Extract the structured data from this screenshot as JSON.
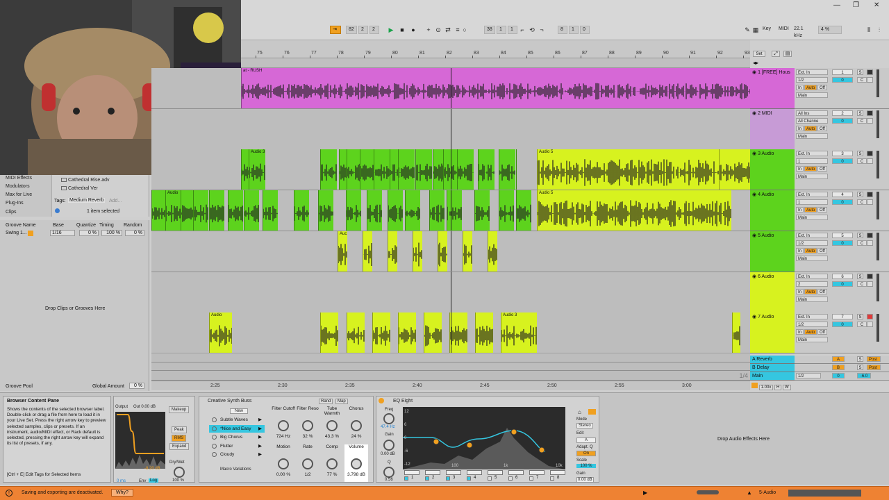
{
  "window": {
    "minimize": "—",
    "restore": "❐",
    "close": "✕"
  },
  "transport": {
    "tempo_controls": [
      "82",
      "2",
      "2"
    ],
    "position": [
      "38",
      "1",
      "1"
    ],
    "loop_length": [
      "8",
      "1",
      "0"
    ],
    "key_label": "Key",
    "midi_label": "MIDI",
    "sample_rate": "22.1 kHz",
    "cpu": "4 %"
  },
  "ruler": {
    "bars": [
      "75",
      "76",
      "77",
      "78",
      "79",
      "80",
      "81",
      "82",
      "83",
      "84",
      "85",
      "86",
      "87",
      "88",
      "89",
      "90",
      "91",
      "92",
      "93"
    ],
    "set_label": "Set",
    "times": [
      "2:25",
      "2:30",
      "2:35",
      "2:40",
      "2:45",
      "2:50",
      "2:55",
      "3:00"
    ]
  },
  "browser": {
    "categories": [
      "MIDI Effects",
      "Modulators",
      "Max for Live",
      "Plug-Ins",
      "Clips"
    ],
    "files": [
      "Cathedral Rise.adv",
      "Cathedral Ver"
    ],
    "tags_label": "Tags:",
    "tag_value": "Medium Reverb",
    "tag_add": "Add...",
    "selection": "1 item selected"
  },
  "groove": {
    "headers": [
      "Groove Name",
      "Base",
      "Quantize",
      "Timing",
      "Random"
    ],
    "row": {
      "name": "Swing 1...",
      "base": "1/16",
      "quantize": "0 %",
      "timing": "100 %",
      "random": "0 %"
    },
    "drop_hint": "Drop Clips or Grooves Here",
    "pool_label": "Groove Pool",
    "global_label": "Global Amount",
    "global_value": "0 %"
  },
  "tracks": [
    {
      "name": "1 [FREE] Hous",
      "color": "#d668d6",
      "input": "Ext. In",
      "channel": "1/2",
      "number": "1",
      "volume": "0",
      "pan": "C",
      "output": "Main",
      "clip_label": "at - RUSH"
    },
    {
      "name": "2 MIDI",
      "color": "#c79bd6",
      "input": "All Ins",
      "channel": "All Channe",
      "number": "2",
      "volume": "0",
      "pan": "C",
      "output": "Main"
    },
    {
      "name": "3 Audio",
      "color": "#5dd31d",
      "input": "Ext. In",
      "channel": "1",
      "number": "3",
      "volume": "0",
      "pan": "C",
      "output": "Main",
      "clip_label": "Audio 3",
      "clip_label_b": "Audio 5"
    },
    {
      "name": "4 Audio",
      "color": "#5dd31d",
      "input": "Ext. In",
      "channel": "1",
      "number": "4",
      "volume": "0",
      "pan": "C",
      "output": "Main",
      "clip_label": "Audio",
      "clip_label_b": "Audio 5"
    },
    {
      "name": "5 Audio",
      "color": "#5dd31d",
      "input": "Ext. In",
      "channel": "1/2",
      "number": "5",
      "volume": "0",
      "pan": "C",
      "output": "Main",
      "clip_label": "Auc"
    },
    {
      "name": "6 Audio",
      "color": "#d7f21f",
      "input": "Ext. In",
      "channel": "2",
      "number": "6",
      "volume": "0",
      "pan": "C",
      "output": "Main"
    },
    {
      "name": "7 Audio",
      "color": "#d7f21f",
      "input": "Ext. In",
      "channel": "1/2",
      "number": "7",
      "volume": "0",
      "pan": "C",
      "output": "Main",
      "clip_label": "Audio",
      "clip_label_b": "Audio 3"
    }
  ],
  "returns": [
    {
      "name": "A Reverb",
      "letter": "A",
      "send": "Post"
    },
    {
      "name": "B Delay",
      "letter": "B",
      "send": "Post"
    },
    {
      "name": "Main",
      "output": "1/2",
      "volume": "0",
      "level": "-6.0"
    }
  ],
  "monitor": {
    "in": "In",
    "auto": "Auto",
    "off": "Off",
    "solo": "S",
    "page": "1/4",
    "zoom": "1.00x",
    "h": "H",
    "w": "W"
  },
  "info_panel": {
    "title": "Browser Content Pane",
    "body": "Shows the contents of the selected browser label. Double-click or drag a file from here to load it in your Live Set. Press the right arrow key to preview selected samples, clips or presets. If an instrument, audio/MIDI effect, or Rack default is selected, pressing the right arrow key will expand its list of presets, if any.",
    "shortcut": "[Ctrl + E] Edit Tags for Selected Items"
  },
  "compressor": {
    "output_label": "Output",
    "output_value": "Out 0.00 dB",
    "makeup": "Makeup",
    "peak": "Peak",
    "rms": "RMS",
    "expand": "Expand",
    "dry_wet_label": "Dry/Wet",
    "dry_wet": "100 %",
    "gr": "-8.20 dB",
    "attack": "0 ms",
    "env": "Env",
    "log": "Log"
  },
  "rack": {
    "title": "Creative Synth Buss",
    "rand": "Rand",
    "map": "Map",
    "new": "New",
    "presets": [
      "Subtle Waves",
      "*Nice and Easy",
      "Big Chorus",
      "Flutter",
      "Cloudy"
    ],
    "macros": [
      {
        "name": "Filter Cutoff",
        "value": "724 Hz"
      },
      {
        "name": "Filter Reso",
        "value": "32 %"
      },
      {
        "name": "Tube Warmth",
        "value": "43.3 %"
      },
      {
        "name": "Chorus",
        "value": "24 %"
      },
      {
        "name": "Motion",
        "value": "0.00 %"
      },
      {
        "name": "Rate",
        "value": "1/2"
      },
      {
        "name": "Comp",
        "value": "77 %"
      },
      {
        "name": "Volume",
        "value": "3.798 dB"
      }
    ],
    "variations": "Macro Variations"
  },
  "eq": {
    "title": "EQ Eight",
    "freq_label": "Freq",
    "freq": "47.4 Hz",
    "gain_label": "Gain",
    "gain": "0.00 dB",
    "q_label": "Q",
    "q": "0.56",
    "db_ticks": [
      "12",
      "6",
      "0",
      "-6",
      "-12"
    ],
    "freq_ticks": [
      "100",
      "1k",
      "10k"
    ],
    "bands": [
      "1",
      "2",
      "3",
      "4",
      "5",
      "6",
      "7",
      "8"
    ],
    "mode_label": "Mode",
    "mode": "Stereo",
    "edit_label": "Edit",
    "edit": "A",
    "adapt_label": "Adapt. Q",
    "adapt": "On",
    "scale_label": "Scale",
    "scale": "100 %",
    "out_gain_label": "Gain",
    "out_gain": "0.00 dB"
  },
  "drop_effects": "Drop Audio Effects Here",
  "statusbar": {
    "message": "Saving and exporting are deactivated.",
    "why": "Why?",
    "track": "5-Audio"
  },
  "colors": {
    "magenta": "#d668d6",
    "lime": "#d7f21f",
    "green": "#5dd31d",
    "orange": "#f0a020",
    "cyan": "#35c6e0",
    "status": "#ee8233"
  }
}
